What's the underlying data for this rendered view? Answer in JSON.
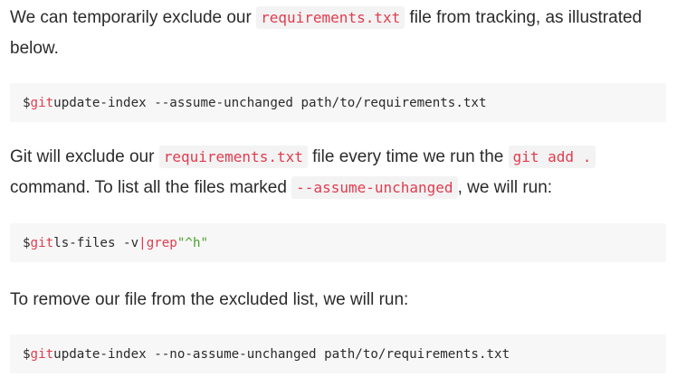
{
  "paragraph1": {
    "text_before": "We can temporarily exclude our ",
    "code": "requirements.txt",
    "text_after": " file from tracking, as illustrated below."
  },
  "code_block1": {
    "prompt": "$",
    "command": "git",
    "rest": "update-index --assume-unchanged path/to/requirements.txt"
  },
  "paragraph2": {
    "text_1": "Git will exclude our ",
    "code_1": "requirements.txt",
    "text_2": " file every time we run the ",
    "code_2": "git add .",
    "text_3": " command. To list all the files marked ",
    "code_3": "--assume-unchanged",
    "text_4": ", we will run:"
  },
  "code_block2": {
    "prompt": "$",
    "command": "git",
    "args": "ls-files -v",
    "pipe": "|",
    "grep": "grep",
    "pattern": "\"^h\""
  },
  "paragraph3": {
    "text": "To remove our file from the excluded list, we will run:"
  },
  "code_block3": {
    "prompt": "$",
    "command": "git",
    "rest": "update-index --no-assume-unchanged path/to/requirements.txt"
  },
  "colors": {
    "inline_code_text": "#e03c4f",
    "inline_code_bg": "#f3f3f3",
    "code_block_bg": "#f7f7f7",
    "string": "#4aa02c",
    "body_text": "#2b2b2b"
  }
}
